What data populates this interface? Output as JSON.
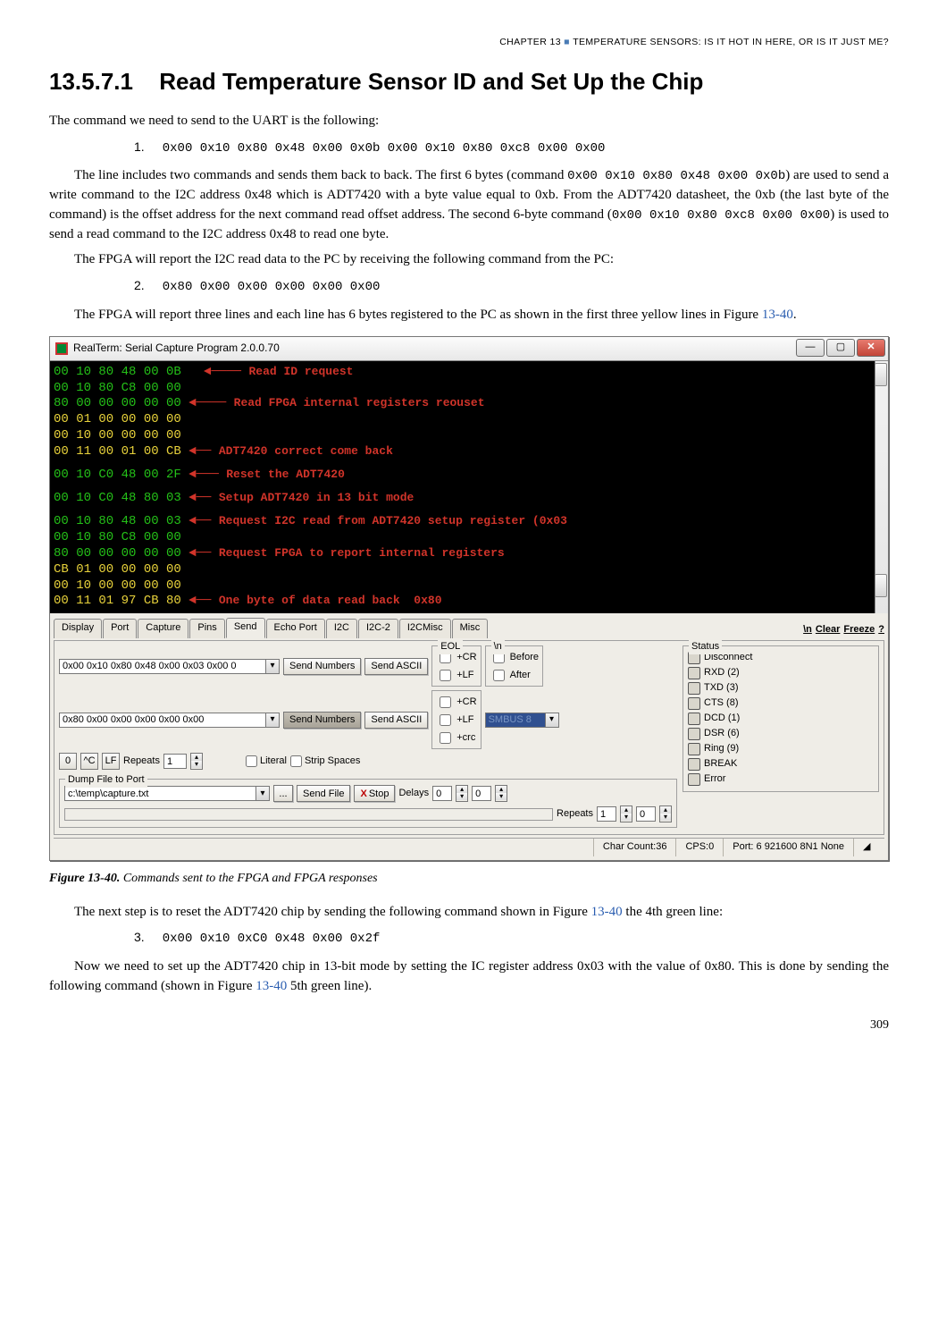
{
  "chapter_header_pre": "CHAPTER 13 ",
  "chapter_header_post": " TEMPERATURE SENSORS: IS IT HOT IN HERE, OR IS IT JUST ME?",
  "section_number": "13.5.7.1",
  "section_title": "Read Temperature Sensor ID and Set Up the Chip",
  "p1": "The command we need to send to the UART is the following:",
  "cmd1_num": "1.",
  "cmd1": "0x00 0x10 0x80 0x48 0x00 0x0b 0x00 0x10 0x80 0xc8 0x00 0x00",
  "p2a": "The line includes two commands and sends them back to back. The first 6 bytes (command ",
  "p2_code1": "0x00 0x10 0x80 0x48 0x00 0x0b",
  "p2b": ") are used to send a write command to the I2C address 0x48 which is ADT7420 with a byte value equal to 0xb. From the ADT7420 datasheet, the 0xb (the last byte of the command) is the offset address for the next command read offset address. The second 6-byte command (",
  "p2_code2": "0x00 0x10 0x80 0xc8 0x00 0x00",
  "p2c": ") is used to send a read command to the I2C address 0x48 to read one byte.",
  "p3": "The FPGA will report the I2C read data to the PC by receiving the following command from the PC:",
  "cmd2_num": "2.",
  "cmd2": "0x80 0x00 0x00 0x00 0x00 0x00",
  "p4a": "The FPGA will report three lines and each line has 6 bytes registered to the PC as shown in the first three yellow lines in Figure ",
  "p4_link": "13-40",
  "p4b": ".",
  "window_title": "RealTerm: Serial Capture Program 2.0.0.70",
  "term": {
    "l01": {
      "hex": "00 10 80 48 00 0B",
      "a": "Read ID request"
    },
    "l02": {
      "hex": "00 10 80 C8 00 00"
    },
    "l03": {
      "hex": "80 00 00 00 00 00",
      "a": "Read FPGA internal registers reouset"
    },
    "l04": {
      "hex": "00 01 00 00 00 00"
    },
    "l05": {
      "hex": "00 10 00 00 00 00"
    },
    "l06": {
      "hex": "00 11 00 01 00 CB",
      "a": "ADT7420 correct come back"
    },
    "l07": {
      "hex": "00 10 C0 48 00 2F",
      "a": "Reset the ADT7420"
    },
    "l08": {
      "hex": "00 10 C0 48 80 03",
      "a": "Setup ADT7420 in 13 bit mode"
    },
    "l09": {
      "hex": "00 10 80 48 00 03",
      "a": "Request I2C read from ADT7420 setup register (0x03"
    },
    "l10": {
      "hex": "00 10 80 C8 00 00"
    },
    "l11": {
      "hex": "80 00 00 00 00 00",
      "a": "Request FPGA to report internal registers"
    },
    "l12": {
      "hex": "CB 01 00 00 00 00"
    },
    "l13": {
      "hex": "00 10 00 00 00 00"
    },
    "l14": {
      "hex": "00 11 01 97 CB 80",
      "a": "One byte of data read back  0x80"
    }
  },
  "tabs": {
    "display": "Display",
    "port": "Port",
    "capture": "Capture",
    "pins": "Pins",
    "send": "Send",
    "echo": "Echo Port",
    "i2c": "I2C",
    "i2c2": "I2C-2",
    "i2cmisc": "I2CMisc",
    "misc": "Misc",
    "newline": "\\n",
    "clear": "Clear",
    "freeze": "Freeze",
    "help": "?"
  },
  "p": {
    "send1_value": "0x00 0x10 0x80 0x48 0x00 0x03 0x00 0",
    "send2_value": "0x80 0x00 0x00 0x00 0x00 0x00",
    "send_numbers": "Send Numbers",
    "send_ascii": "Send ASCII",
    "zero": "0",
    "ctrlc": "^C",
    "lf": "LF",
    "repeats_lbl": "Repeats",
    "repeats_val": "1",
    "literal": "Literal",
    "strip": "Strip Spaces",
    "eol": "EOL",
    "cr": "+CR",
    "lf2": "+LF",
    "crc": "+crc",
    "slashn": "\\n",
    "before": "Before",
    "after": "After",
    "dump_legend": "Dump File to Port",
    "dump_file": "c:\\temp\\capture.txt",
    "dots": "...",
    "send_file": "Send File",
    "stop": "Stop",
    "x": "X",
    "delays": "Delays",
    "delays_v": "0",
    "zero2": "0",
    "repeats2_lbl": "Repeats",
    "repeats2_v": "1",
    "zero3": "0"
  },
  "status": {
    "legend": "Status",
    "items": [
      "Disconnect",
      "RXD (2)",
      "TXD (3)",
      "CTS (8)",
      "DCD (1)",
      "DSR (6)",
      "Ring (9)",
      "BREAK",
      "Error"
    ]
  },
  "statusbar": {
    "chars": "Char Count:36",
    "cps": "CPS:0",
    "port": "Port: 6 921600 8N1 None"
  },
  "caption_label": "Figure 13-40.",
  "caption_text": "  Commands sent to the FPGA and FPGA responses",
  "p5a": "The next step is to reset the ADT7420 chip by sending the following command shown in Figure ",
  "p5_link": "13-40",
  "p5b": " the 4th green line:",
  "cmd3_num": "3.",
  "cmd3": "0x00 0x10 0xC0 0x48 0x00 0x2f",
  "p6a": "Now we need to set up the ADT7420 chip in 13-bit mode by setting the IC register address 0x03 with the value of 0x80. This is done by sending the following command (shown in Figure ",
  "p6_link": "13-40",
  "p6b": " 5th green line).",
  "page_number": "309"
}
